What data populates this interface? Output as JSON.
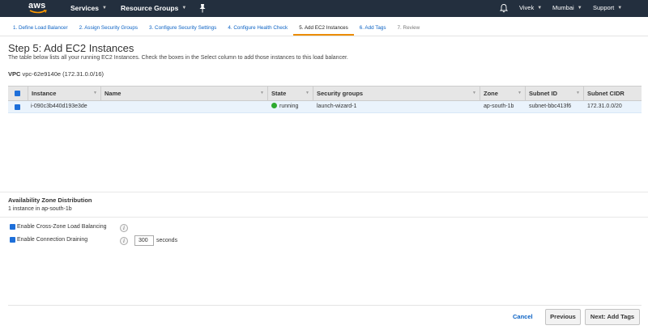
{
  "nav": {
    "logo": "aws",
    "services": "Services",
    "resource_groups": "Resource Groups",
    "user": "Vivek",
    "region": "Mumbai",
    "support": "Support"
  },
  "tabs": [
    {
      "label": "1. Define Load Balancer"
    },
    {
      "label": "2. Assign Security Groups"
    },
    {
      "label": "3. Configure Security Settings"
    },
    {
      "label": "4. Configure Health Check"
    },
    {
      "label": "5. Add EC2 Instances"
    },
    {
      "label": "6. Add Tags"
    },
    {
      "label": "7. Review"
    }
  ],
  "page": {
    "title": "Step 5: Add EC2 Instances",
    "description": "The table below lists all your running EC2 Instances. Check the boxes in the Select column to add those instances to this load balancer.",
    "vpc_label": "VPC",
    "vpc_value": "vpc-62e9140e (172.31.0.0/16)"
  },
  "table": {
    "headers": {
      "instance": "Instance",
      "name": "Name",
      "state": "State",
      "security_groups": "Security groups",
      "zone": "Zone",
      "subnet_id": "Subnet ID",
      "subnet_cidr": "Subnet CIDR"
    },
    "rows": [
      {
        "instance": "i-090c3b440d193e3de",
        "name": "",
        "state": "running",
        "security_groups": "launch-wizard-1",
        "zone": "ap-south-1b",
        "subnet_id": "subnet-bbc413f6",
        "subnet_cidr": "172.31.0.0/20"
      }
    ]
  },
  "az": {
    "title": "Availability Zone Distribution",
    "desc": "1 instance in ap-south-1b"
  },
  "options": {
    "cross_zone": "Enable Cross-Zone Load Balancing",
    "draining": "Enable Connection Draining",
    "draining_value": "300",
    "seconds": "seconds"
  },
  "footer": {
    "cancel": "Cancel",
    "previous": "Previous",
    "next": "Next: Add Tags"
  },
  "colors": {
    "nav_bg": "#232f3e",
    "link": "#0b62c4",
    "active_tab": "#eb8c00",
    "running": "#2eaa2e"
  }
}
